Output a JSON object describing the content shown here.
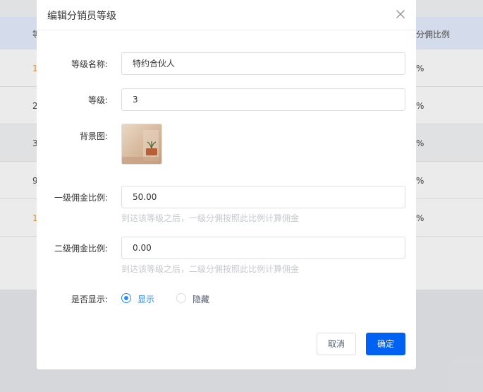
{
  "background_table": {
    "header_left": "等",
    "header_right": "分佣比例",
    "rows": [
      {
        "left": "1",
        "right": "%"
      },
      {
        "left": "2",
        "right": "%"
      },
      {
        "left": "3",
        "right": "%"
      },
      {
        "left": "9",
        "right": "%"
      },
      {
        "left": "1",
        "right": "%"
      }
    ]
  },
  "dialog": {
    "title": "编辑分销员等级",
    "close_icon": "close-icon",
    "fields": {
      "level_name": {
        "label": "等级名称:",
        "value": "特约合伙人"
      },
      "level": {
        "label": "等级:",
        "value": "3"
      },
      "background_image": {
        "label": "背景图:"
      },
      "first_commission": {
        "label": "一级佣金比例:",
        "value": "50.00",
        "hint": "到达该等级之后，一级分佣按照此比例计算佣金"
      },
      "second_commission": {
        "label": "二级佣金比例:",
        "value": "0.00",
        "hint": "到达该等级之后，二级分佣按照此比例计算佣金"
      },
      "display": {
        "label": "是否显示:",
        "options": [
          "显示",
          "隐藏"
        ],
        "selected": "显示"
      }
    },
    "buttons": {
      "cancel": "取消",
      "confirm": "确定"
    }
  },
  "colors": {
    "primary": "#0061f2",
    "radio_checked": "#2d8cf0",
    "hint": "#c5c8ce"
  }
}
